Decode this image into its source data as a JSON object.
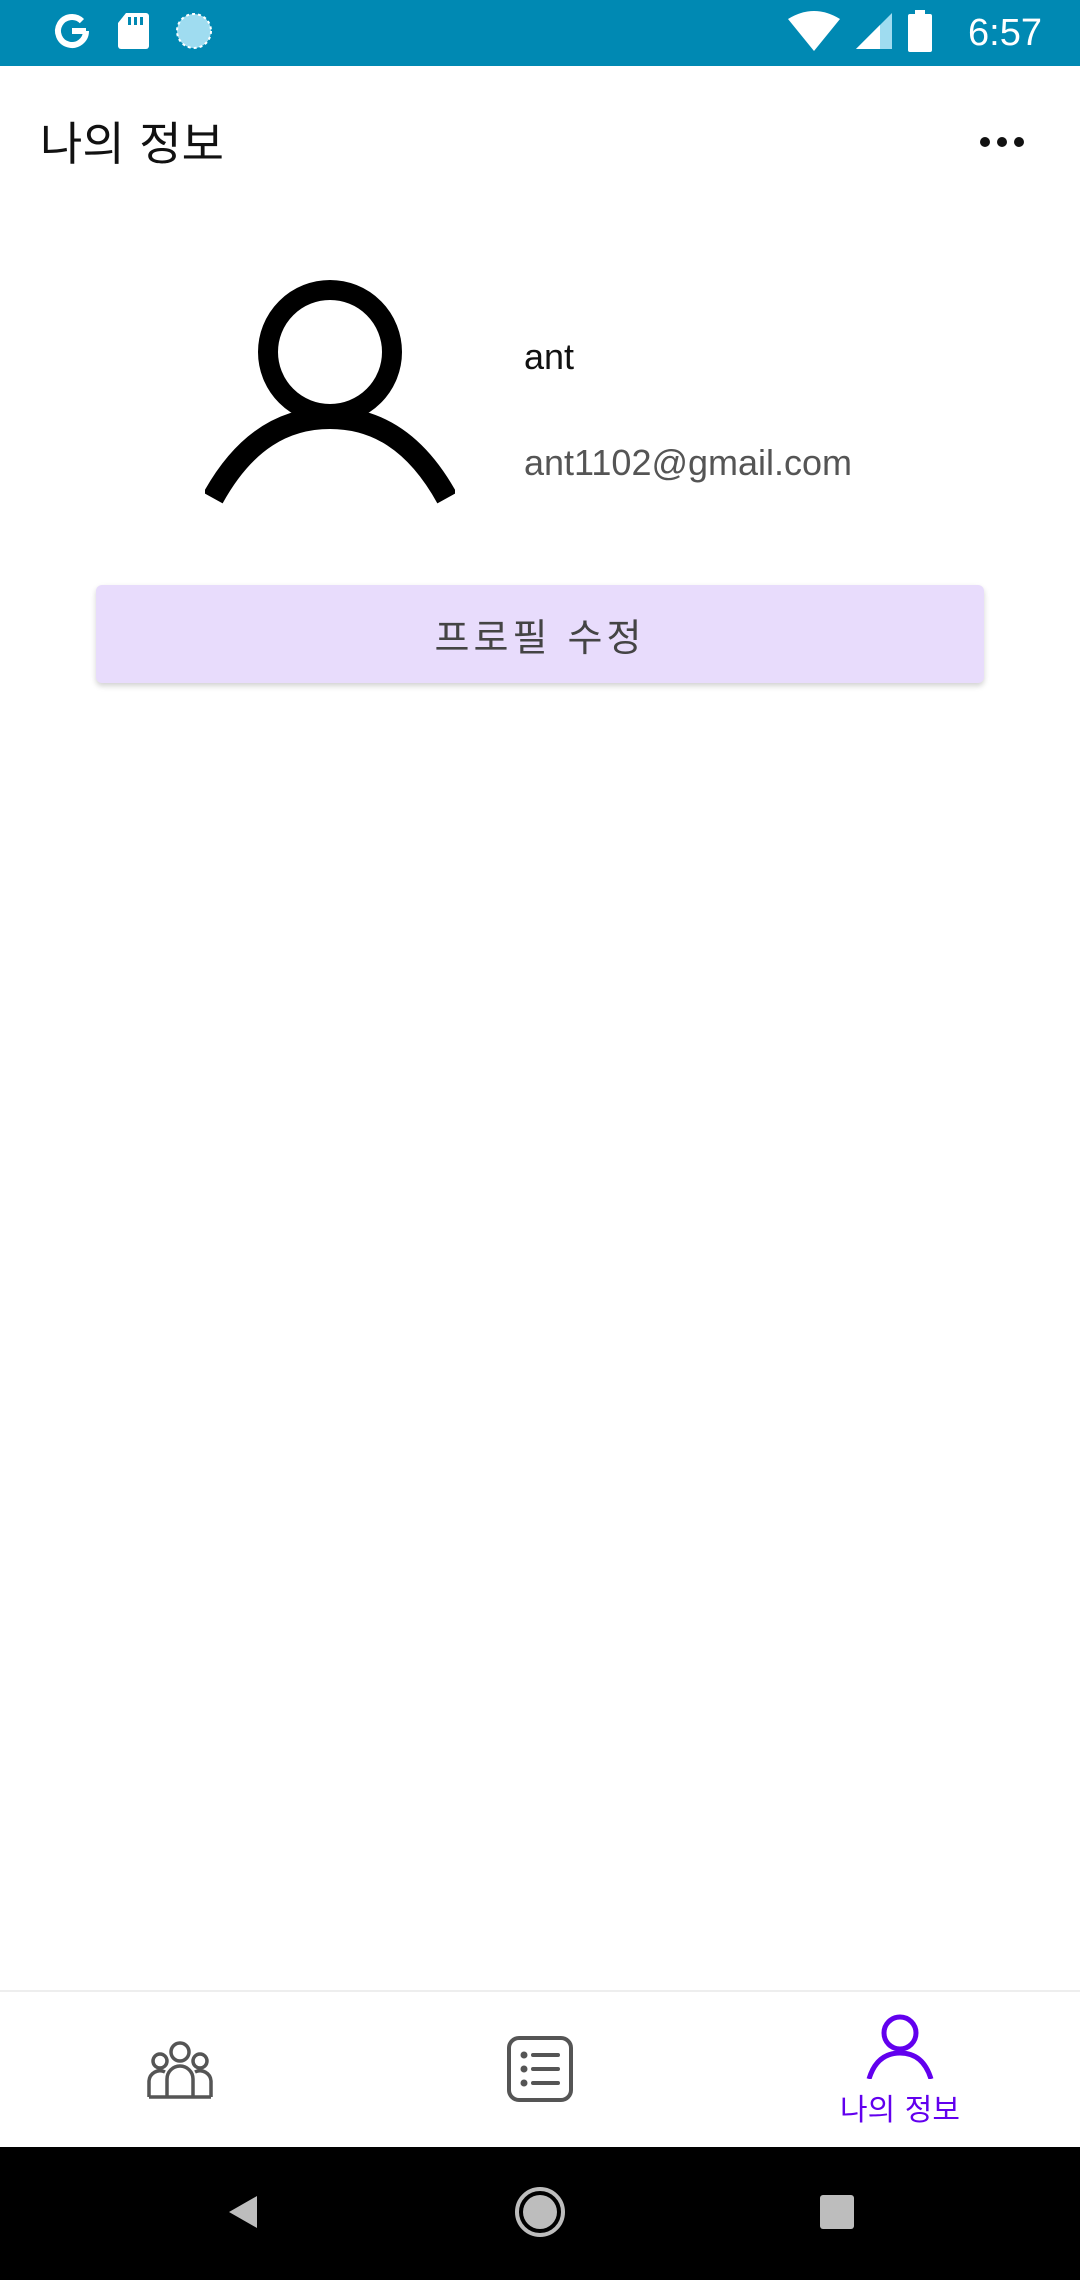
{
  "status_bar": {
    "time": "6:57",
    "icons": [
      "google-icon",
      "sd-card-icon",
      "sync-icon",
      "wifi-icon",
      "cell-signal-icon",
      "battery-icon"
    ],
    "background": "#0089b3"
  },
  "app_bar": {
    "title": "나의 정보",
    "menu_icon": "more-horizontal-icon"
  },
  "profile": {
    "avatar_icon": "person-icon",
    "name": "ant",
    "email": "ant1102@gmail.com"
  },
  "actions": {
    "edit_profile_label": "프로필 수정",
    "edit_profile_color": "#e8dcfc"
  },
  "bottom_nav": {
    "items": [
      {
        "icon": "group-icon",
        "label": "",
        "active": false
      },
      {
        "icon": "list-icon",
        "label": "",
        "active": false
      },
      {
        "icon": "person-icon",
        "label": "나의 정보",
        "active": true
      }
    ],
    "active_color": "#6200ee",
    "inactive_color": "#555555"
  },
  "system_nav": {
    "icons": [
      "back-icon",
      "home-icon",
      "recents-icon"
    ]
  }
}
